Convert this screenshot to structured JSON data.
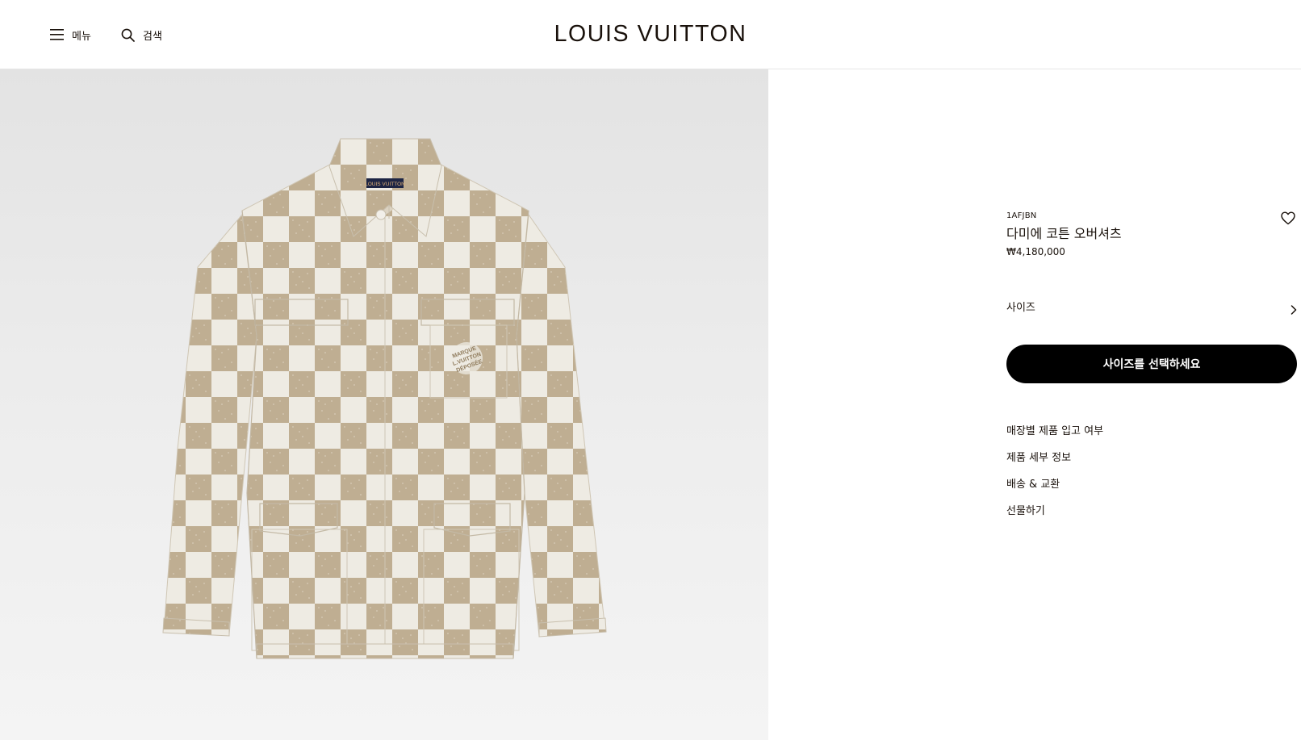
{
  "header": {
    "menu_label": "메뉴",
    "search_label": "검색",
    "logo_text": "LOUIS VUITTON",
    "menu_icon": "hamburger-icon",
    "search_icon": "search-icon"
  },
  "product": {
    "sku": "1AFJBN",
    "name": "다미에 코튼 오버셔츠",
    "price": "₩4,180,000",
    "wishlist_icon": "heart-icon",
    "image_alt": "damier-cotton-overshirt-image",
    "label_text": "LOUIS VUITTON",
    "pocket_emblem": "MARQUE LOUIS VUITTON DÉPOSÉE"
  },
  "size": {
    "label": "사이즈",
    "icon": "chevron-right-icon"
  },
  "cta": {
    "label": "사이즈를 선택하세요"
  },
  "links": [
    "매장별 제품 입고 여부",
    "제품 세부 정보",
    "배송 & 교환",
    "선물하기"
  ],
  "colors": {
    "check_light": "#eeebe3",
    "check_dark": "#bfae92",
    "cta_bg": "#000000"
  }
}
